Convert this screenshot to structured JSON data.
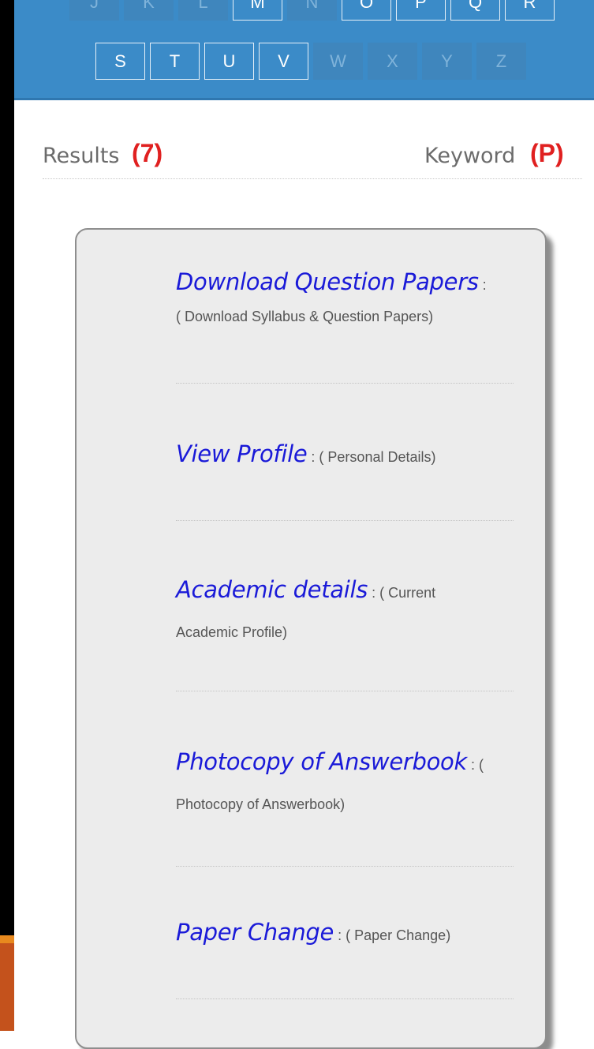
{
  "alphabet": {
    "row1": [
      {
        "letter": "J",
        "active": false
      },
      {
        "letter": "K",
        "active": false
      },
      {
        "letter": "L",
        "active": false
      },
      {
        "letter": "M",
        "active": true
      },
      {
        "letter": "N",
        "active": false
      },
      {
        "letter": "O",
        "active": true
      },
      {
        "letter": "P",
        "active": true
      },
      {
        "letter": "Q",
        "active": true
      },
      {
        "letter": "R",
        "active": true
      }
    ],
    "row2": [
      {
        "letter": "S",
        "active": true
      },
      {
        "letter": "T",
        "active": true
      },
      {
        "letter": "U",
        "active": true
      },
      {
        "letter": "V",
        "active": true
      },
      {
        "letter": "W",
        "active": false
      },
      {
        "letter": "X",
        "active": false
      },
      {
        "letter": "Y",
        "active": false
      },
      {
        "letter": "Z",
        "active": false
      }
    ]
  },
  "results": {
    "label": "Results",
    "count": "(7)",
    "keyword_label": "Keyword",
    "keyword_value": "(P)"
  },
  "items": [
    {
      "title": "Download Question Papers",
      "sep": " :",
      "desc_inline": "",
      "desc_line2": "( Download Syllabus & Question Papers)"
    },
    {
      "title": "View Profile",
      "sep": " : ",
      "desc_inline": "( Personal Details)",
      "desc_line2": ""
    },
    {
      "title": "Academic details",
      "sep": " : ",
      "desc_inline": "( Current",
      "desc_line2": "Academic Profile)"
    },
    {
      "title": "Photocopy of Answerbook",
      "sep": " : ",
      "desc_inline": "(",
      "desc_line2": "Photocopy of Answerbook)"
    },
    {
      "title": "Paper Change",
      "sep": " : ",
      "desc_inline": "( Paper Change)",
      "desc_line2": ""
    }
  ],
  "colors": {
    "header": "#3b8bc8",
    "link": "#1a1ad8",
    "highlight": "#e02020",
    "card": "#ececec"
  }
}
